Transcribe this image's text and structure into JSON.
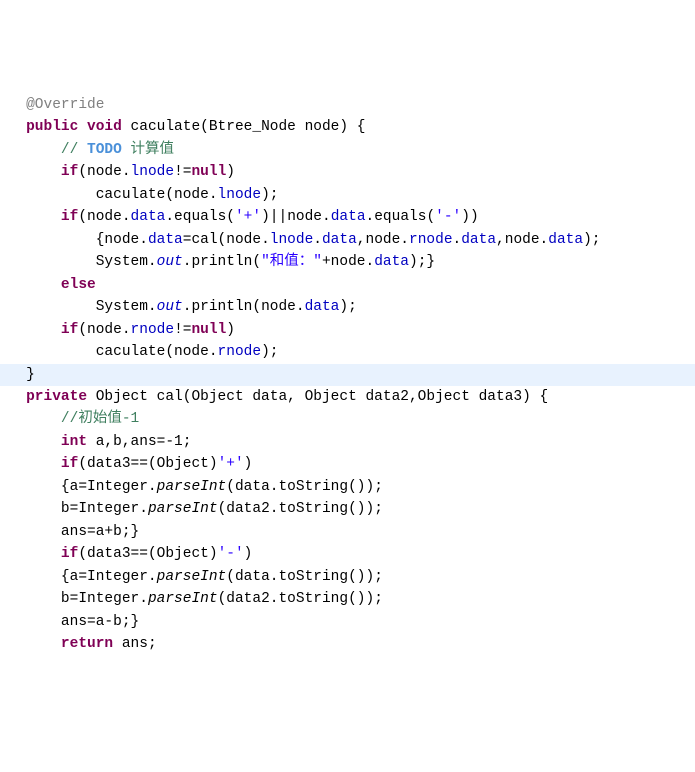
{
  "lines": [
    {
      "cls": "",
      "segs": [
        {
          "t": "   ",
          "c": ""
        },
        {
          "t": "@Override",
          "c": "ann"
        }
      ]
    },
    {
      "cls": "",
      "segs": [
        {
          "t": "   ",
          "c": ""
        },
        {
          "t": "public",
          "c": "kw"
        },
        {
          "t": " ",
          "c": ""
        },
        {
          "t": "void",
          "c": "kw"
        },
        {
          "t": " caculate(Btree_Node node) {",
          "c": ""
        }
      ]
    },
    {
      "cls": "",
      "segs": [
        {
          "t": "       ",
          "c": ""
        },
        {
          "t": "// ",
          "c": "comment"
        },
        {
          "t": "TODO",
          "c": "comment-todo"
        },
        {
          "t": " 计算值",
          "c": "comment"
        }
      ]
    },
    {
      "cls": "",
      "segs": [
        {
          "t": "       ",
          "c": ""
        },
        {
          "t": "if",
          "c": "kw"
        },
        {
          "t": "(node.",
          "c": ""
        },
        {
          "t": "lnode",
          "c": "field"
        },
        {
          "t": "!=",
          "c": ""
        },
        {
          "t": "null",
          "c": "kw"
        },
        {
          "t": ")",
          "c": ""
        }
      ]
    },
    {
      "cls": "",
      "segs": [
        {
          "t": "           caculate(node.",
          "c": ""
        },
        {
          "t": "lnode",
          "c": "field"
        },
        {
          "t": ");",
          "c": ""
        }
      ]
    },
    {
      "cls": "",
      "segs": [
        {
          "t": "       ",
          "c": ""
        },
        {
          "t": "if",
          "c": "kw"
        },
        {
          "t": "(node.",
          "c": ""
        },
        {
          "t": "data",
          "c": "field"
        },
        {
          "t": ".equals(",
          "c": ""
        },
        {
          "t": "'+'",
          "c": "string"
        },
        {
          "t": ")||node.",
          "c": ""
        },
        {
          "t": "data",
          "c": "field"
        },
        {
          "t": ".equals(",
          "c": ""
        },
        {
          "t": "'-'",
          "c": "string"
        },
        {
          "t": "))",
          "c": ""
        }
      ]
    },
    {
      "cls": "",
      "segs": [
        {
          "t": "           {node.",
          "c": ""
        },
        {
          "t": "data",
          "c": "field"
        },
        {
          "t": "=cal(node.",
          "c": ""
        },
        {
          "t": "lnode",
          "c": "field"
        },
        {
          "t": ".",
          "c": ""
        },
        {
          "t": "data",
          "c": "field"
        },
        {
          "t": ",node.",
          "c": ""
        },
        {
          "t": "rnode",
          "c": "field"
        },
        {
          "t": ".",
          "c": ""
        },
        {
          "t": "data",
          "c": "field"
        },
        {
          "t": ",node.",
          "c": ""
        },
        {
          "t": "data",
          "c": "field"
        },
        {
          "t": ");",
          "c": ""
        }
      ]
    },
    {
      "cls": "",
      "segs": [
        {
          "t": "           System.",
          "c": ""
        },
        {
          "t": "out",
          "c": "field static-italic"
        },
        {
          "t": ".println(",
          "c": ""
        },
        {
          "t": "\"和值：\"",
          "c": "string"
        },
        {
          "t": "+node.",
          "c": ""
        },
        {
          "t": "data",
          "c": "field"
        },
        {
          "t": ");}",
          "c": ""
        }
      ]
    },
    {
      "cls": "",
      "segs": [
        {
          "t": "       ",
          "c": ""
        },
        {
          "t": "else",
          "c": "kw"
        }
      ]
    },
    {
      "cls": "",
      "segs": [
        {
          "t": "           System.",
          "c": ""
        },
        {
          "t": "out",
          "c": "field static-italic"
        },
        {
          "t": ".println(node.",
          "c": ""
        },
        {
          "t": "data",
          "c": "field"
        },
        {
          "t": ");",
          "c": ""
        }
      ]
    },
    {
      "cls": "",
      "segs": [
        {
          "t": "       ",
          "c": ""
        },
        {
          "t": "if",
          "c": "kw"
        },
        {
          "t": "(node.",
          "c": ""
        },
        {
          "t": "rnode",
          "c": "field"
        },
        {
          "t": "!=",
          "c": ""
        },
        {
          "t": "null",
          "c": "kw"
        },
        {
          "t": ")",
          "c": ""
        }
      ]
    },
    {
      "cls": "",
      "segs": [
        {
          "t": "           caculate(node.",
          "c": ""
        },
        {
          "t": "rnode",
          "c": "field"
        },
        {
          "t": ");",
          "c": ""
        }
      ]
    },
    {
      "cls": "hl",
      "segs": [
        {
          "t": "   }",
          "c": ""
        }
      ]
    },
    {
      "cls": "",
      "segs": [
        {
          "t": "   ",
          "c": ""
        },
        {
          "t": "private",
          "c": "kw"
        },
        {
          "t": " Object cal(Object data, Object data2,Object data3) {",
          "c": ""
        }
      ]
    },
    {
      "cls": "",
      "segs": [
        {
          "t": "       ",
          "c": ""
        },
        {
          "t": "//初始值-1",
          "c": "comment"
        }
      ]
    },
    {
      "cls": "",
      "segs": [
        {
          "t": "       ",
          "c": ""
        },
        {
          "t": "int",
          "c": "kw"
        },
        {
          "t": " a,b,ans=-1;",
          "c": ""
        }
      ]
    },
    {
      "cls": "",
      "segs": [
        {
          "t": "       ",
          "c": ""
        },
        {
          "t": "if",
          "c": "kw"
        },
        {
          "t": "(data3==(Object)",
          "c": ""
        },
        {
          "t": "'+'",
          "c": "string"
        },
        {
          "t": ")",
          "c": ""
        }
      ]
    },
    {
      "cls": "",
      "segs": [
        {
          "t": "       {a=Integer.",
          "c": ""
        },
        {
          "t": "parseInt",
          "c": "static-italic"
        },
        {
          "t": "(data.toString());",
          "c": ""
        }
      ]
    },
    {
      "cls": "",
      "segs": [
        {
          "t": "       b=Integer.",
          "c": ""
        },
        {
          "t": "parseInt",
          "c": "static-italic"
        },
        {
          "t": "(data2.toString());",
          "c": ""
        }
      ]
    },
    {
      "cls": "",
      "segs": [
        {
          "t": "       ans=a+b;}",
          "c": ""
        }
      ]
    },
    {
      "cls": "",
      "segs": [
        {
          "t": "       ",
          "c": ""
        },
        {
          "t": "if",
          "c": "kw"
        },
        {
          "t": "(data3==(Object)",
          "c": ""
        },
        {
          "t": "'-'",
          "c": "string"
        },
        {
          "t": ")",
          "c": ""
        }
      ]
    },
    {
      "cls": "",
      "segs": [
        {
          "t": "       {a=Integer.",
          "c": ""
        },
        {
          "t": "parseInt",
          "c": "static-italic"
        },
        {
          "t": "(data.toString());",
          "c": ""
        }
      ]
    },
    {
      "cls": "",
      "segs": [
        {
          "t": "       b=Integer.",
          "c": ""
        },
        {
          "t": "parseInt",
          "c": "static-italic"
        },
        {
          "t": "(data2.toString());",
          "c": ""
        }
      ]
    },
    {
      "cls": "",
      "segs": [
        {
          "t": "       ans=a-b;}",
          "c": ""
        }
      ]
    },
    {
      "cls": "",
      "segs": [
        {
          "t": "       ",
          "c": ""
        },
        {
          "t": "return",
          "c": "kw"
        },
        {
          "t": " ans;",
          "c": ""
        }
      ]
    }
  ]
}
